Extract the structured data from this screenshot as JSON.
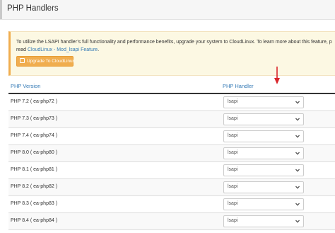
{
  "page": {
    "title": "PHP Handlers"
  },
  "notice": {
    "text_line1": "To utilize the LSAPI handler’s full functionality and performance benefits, upgrade your system to CloudLinux. To learn more about this feature, p",
    "text_line2_prefix": "read ",
    "link_label": "CloudLinux - Mod_lsapi Feature",
    "text_line2_suffix": ".",
    "button_label": "Upgrade To CloudLinux",
    "button_icon": "external-link-icon"
  },
  "table": {
    "headers": {
      "version": "PHP Version",
      "handler": "PHP Handler"
    },
    "rows": [
      {
        "version": "PHP 7.2 ( ea-php72 )",
        "handler": "lsapi"
      },
      {
        "version": "PHP 7.3 ( ea-php73 )",
        "handler": "lsapi"
      },
      {
        "version": "PHP 7.4 ( ea-php74 )",
        "handler": "lsapi"
      },
      {
        "version": "PHP 8.0 ( ea-php80 )",
        "handler": "lsapi"
      },
      {
        "version": "PHP 8.1 ( ea-php81 )",
        "handler": "lsapi"
      },
      {
        "version": "PHP 8.2 ( ea-php82 )",
        "handler": "lsapi"
      },
      {
        "version": "PHP 8.3 ( ea-php83 )",
        "handler": "lsapi"
      },
      {
        "version": "PHP 8.4 ( ea-php84 )",
        "handler": "lsapi"
      }
    ]
  },
  "annotation": {
    "icon": "red-arrow-down-icon",
    "color": "#d9262b"
  },
  "colors": {
    "link": "#3379b5",
    "warning_button": "#f0ad4e",
    "notice_bg": "#fcf8e3"
  }
}
